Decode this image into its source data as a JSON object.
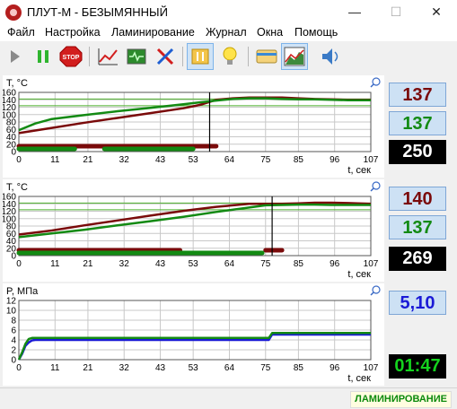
{
  "window": {
    "title": "ПЛУТ-М - БЕЗЫМЯННЫЙ",
    "minimize": "—",
    "maximize": "☐",
    "close": "✕"
  },
  "menu": [
    "Файл",
    "Настройка",
    "Ламинирование",
    "Журнал",
    "Окна",
    "Помощь"
  ],
  "toolbar": [
    {
      "name": "play-icon",
      "active": false
    },
    {
      "name": "pause-icon",
      "active": false
    },
    {
      "name": "stop-icon",
      "label": "STOP",
      "active": false
    },
    {
      "name": "chart-icon",
      "active": false
    },
    {
      "name": "monitor-icon",
      "active": false
    },
    {
      "name": "tools-icon",
      "active": false
    },
    {
      "name": "heater-toggle-icon",
      "active": true
    },
    {
      "name": "lightbulb-icon",
      "active": false
    },
    {
      "name": "card-icon",
      "active": false
    },
    {
      "name": "graph-view-icon",
      "active": true
    },
    {
      "name": "speaker-icon",
      "active": false
    }
  ],
  "colors": {
    "red": "#7a0a0a",
    "green": "#138a13",
    "blue": "#1a1ad6",
    "limit": "#4caf2c"
  },
  "readouts": {
    "panel1": {
      "red": "137",
      "green": "137",
      "setpoint": "250"
    },
    "panel2": {
      "red": "140",
      "green": "137",
      "setpoint": "269"
    },
    "panel3": {
      "pressure": "5,10",
      "timer": "01:47"
    }
  },
  "status": "ЛАМИНИРОВАНИЕ",
  "chart_data": [
    {
      "type": "line",
      "ylabel": "T, °C",
      "xlabel": "t, сек",
      "xlim": [
        0,
        107
      ],
      "ylim": [
        0,
        160
      ],
      "xticks": [
        0,
        11,
        21,
        32,
        43,
        53,
        64,
        75,
        85,
        96,
        107
      ],
      "yticks": [
        0,
        20,
        40,
        60,
        80,
        100,
        120,
        140,
        160
      ],
      "grid": true,
      "limit_lines": [
        124,
        142
      ],
      "marker_x": 58,
      "series": [
        {
          "color": "red",
          "x": [
            0,
            10,
            20,
            30,
            40,
            50,
            55,
            60,
            65,
            70,
            75,
            80,
            85,
            90,
            95,
            100,
            107
          ],
          "y": [
            50,
            64,
            78,
            91,
            104,
            117,
            126,
            140,
            144,
            146,
            146,
            146,
            144,
            142,
            141,
            140,
            140
          ]
        },
        {
          "color": "green",
          "x": [
            0,
            5,
            10,
            20,
            30,
            40,
            50,
            55,
            60,
            65,
            70,
            75,
            80,
            85,
            90,
            95,
            100,
            107
          ],
          "y": [
            58,
            76,
            88,
            99,
            109,
            118,
            128,
            133,
            138,
            142,
            144,
            144,
            142,
            141,
            141,
            140,
            139,
            139
          ]
        }
      ],
      "bars": [
        {
          "color": "red",
          "segments": [
            [
              0,
              60
            ]
          ]
        },
        {
          "color": "green",
          "segments": [
            [
              0,
              17
            ],
            [
              26,
              53
            ]
          ]
        }
      ]
    },
    {
      "type": "line",
      "ylabel": "T, °C",
      "xlabel": "t, сек",
      "xlim": [
        0,
        107
      ],
      "ylim": [
        0,
        160
      ],
      "xticks": [
        0,
        11,
        21,
        32,
        43,
        53,
        64,
        75,
        85,
        96,
        107
      ],
      "yticks": [
        0,
        20,
        40,
        60,
        80,
        100,
        120,
        140,
        160
      ],
      "grid": true,
      "limit_lines": [
        124,
        142
      ],
      "marker_x": 77,
      "series": [
        {
          "color": "red",
          "x": [
            0,
            10,
            20,
            30,
            40,
            50,
            60,
            70,
            75,
            80,
            85,
            90,
            95,
            100,
            107
          ],
          "y": [
            57,
            68,
            82,
            95,
            108,
            121,
            132,
            140,
            140,
            140,
            141,
            143,
            143,
            142,
            140
          ]
        },
        {
          "color": "green",
          "x": [
            0,
            10,
            20,
            30,
            40,
            50,
            60,
            70,
            75,
            80,
            85,
            90,
            95,
            100,
            107
          ],
          "y": [
            50,
            60,
            70,
            82,
            93,
            105,
            118,
            130,
            136,
            137,
            138,
            138,
            137,
            137,
            137
          ]
        }
      ],
      "bars": [
        {
          "color": "red",
          "segments": [
            [
              0,
              49
            ],
            [
              75,
              80
            ]
          ]
        },
        {
          "color": "green",
          "segments": [
            [
              0,
              74
            ]
          ]
        }
      ]
    },
    {
      "type": "line",
      "ylabel": "P, МПа",
      "xlabel": "t, сек",
      "xlim": [
        0,
        107
      ],
      "ylim": [
        0,
        12
      ],
      "xticks": [
        0,
        11,
        21,
        32,
        43,
        53,
        64,
        75,
        85,
        96,
        107
      ],
      "yticks": [
        0,
        2,
        4,
        6,
        8,
        10,
        12
      ],
      "grid": true,
      "limit_lines": [],
      "series": [
        {
          "color": "blue",
          "x": [
            0,
            1,
            2,
            3,
            4,
            5,
            76,
            77,
            107
          ],
          "y": [
            0,
            1.2,
            2.8,
            3.5,
            3.9,
            4.0,
            4.0,
            5.1,
            5.1
          ]
        },
        {
          "color": "green",
          "x": [
            0,
            1,
            2,
            3,
            4,
            5,
            76,
            77,
            107
          ],
          "y": [
            0,
            1.5,
            3.2,
            4.2,
            4.4,
            4.4,
            4.4,
            5.4,
            5.4
          ]
        }
      ],
      "bars": []
    }
  ]
}
